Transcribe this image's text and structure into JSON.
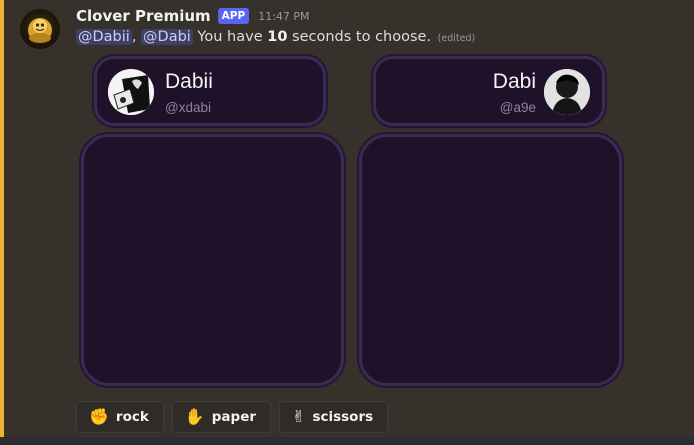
{
  "message": {
    "author": "Clover Premium",
    "badge": "APP",
    "timestamp": "11:47 PM",
    "mention_1": "@Dabii",
    "separator": ", ",
    "mention_2": "@Dabi",
    "text_before": " You have ",
    "seconds": "10",
    "text_after": " seconds to choose.",
    "edited": "(edited)"
  },
  "players": [
    {
      "name": "Dabii",
      "handle": "@xdabi"
    },
    {
      "name": "Dabi",
      "handle": "@a9e"
    }
  ],
  "buttons": [
    {
      "emoji": "✊",
      "label": "rock",
      "icon": "fist-icon"
    },
    {
      "emoji": "✋",
      "label": "paper",
      "icon": "raised-hand-icon"
    },
    {
      "emoji": "✌",
      "label": "scissors",
      "icon": "victory-hand-icon"
    }
  ],
  "colors": {
    "accent_bar": "#f0b232",
    "app_badge": "#5865f2",
    "card_background": "#1f1129",
    "card_border": "#3b2a52"
  }
}
